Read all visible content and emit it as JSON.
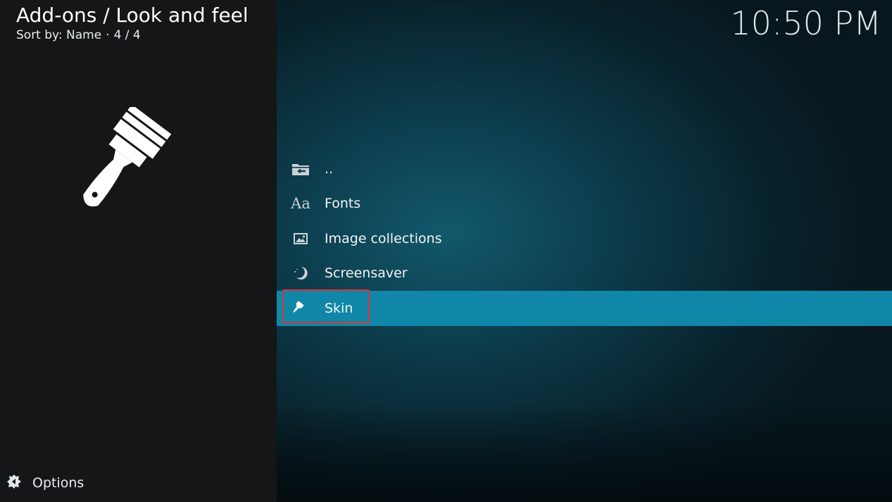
{
  "header": {
    "title": "Add-ons / Look and feel",
    "sort_label": "Sort by: Name",
    "separator": "·",
    "count": "4 / 4"
  },
  "clock": "10:50 PM",
  "hero": {
    "icon": "paintbrush-icon"
  },
  "list": {
    "items": [
      {
        "label": "..",
        "icon": "folder-back-icon",
        "selected": false
      },
      {
        "label": "Fonts",
        "icon": "font-aa-icon",
        "icon_text": "Aa",
        "selected": false
      },
      {
        "label": "Image collections",
        "icon": "image-icon",
        "selected": false
      },
      {
        "label": "Screensaver",
        "icon": "moon-icon",
        "selected": false
      },
      {
        "label": "Skin",
        "icon": "brush-icon",
        "selected": true
      }
    ]
  },
  "footer": {
    "options_label": "Options",
    "options_icon": "options-gear-icon"
  },
  "colors": {
    "selection": "#1087a8",
    "highlight_border": "#e0312f",
    "left_panel": "#141617"
  }
}
